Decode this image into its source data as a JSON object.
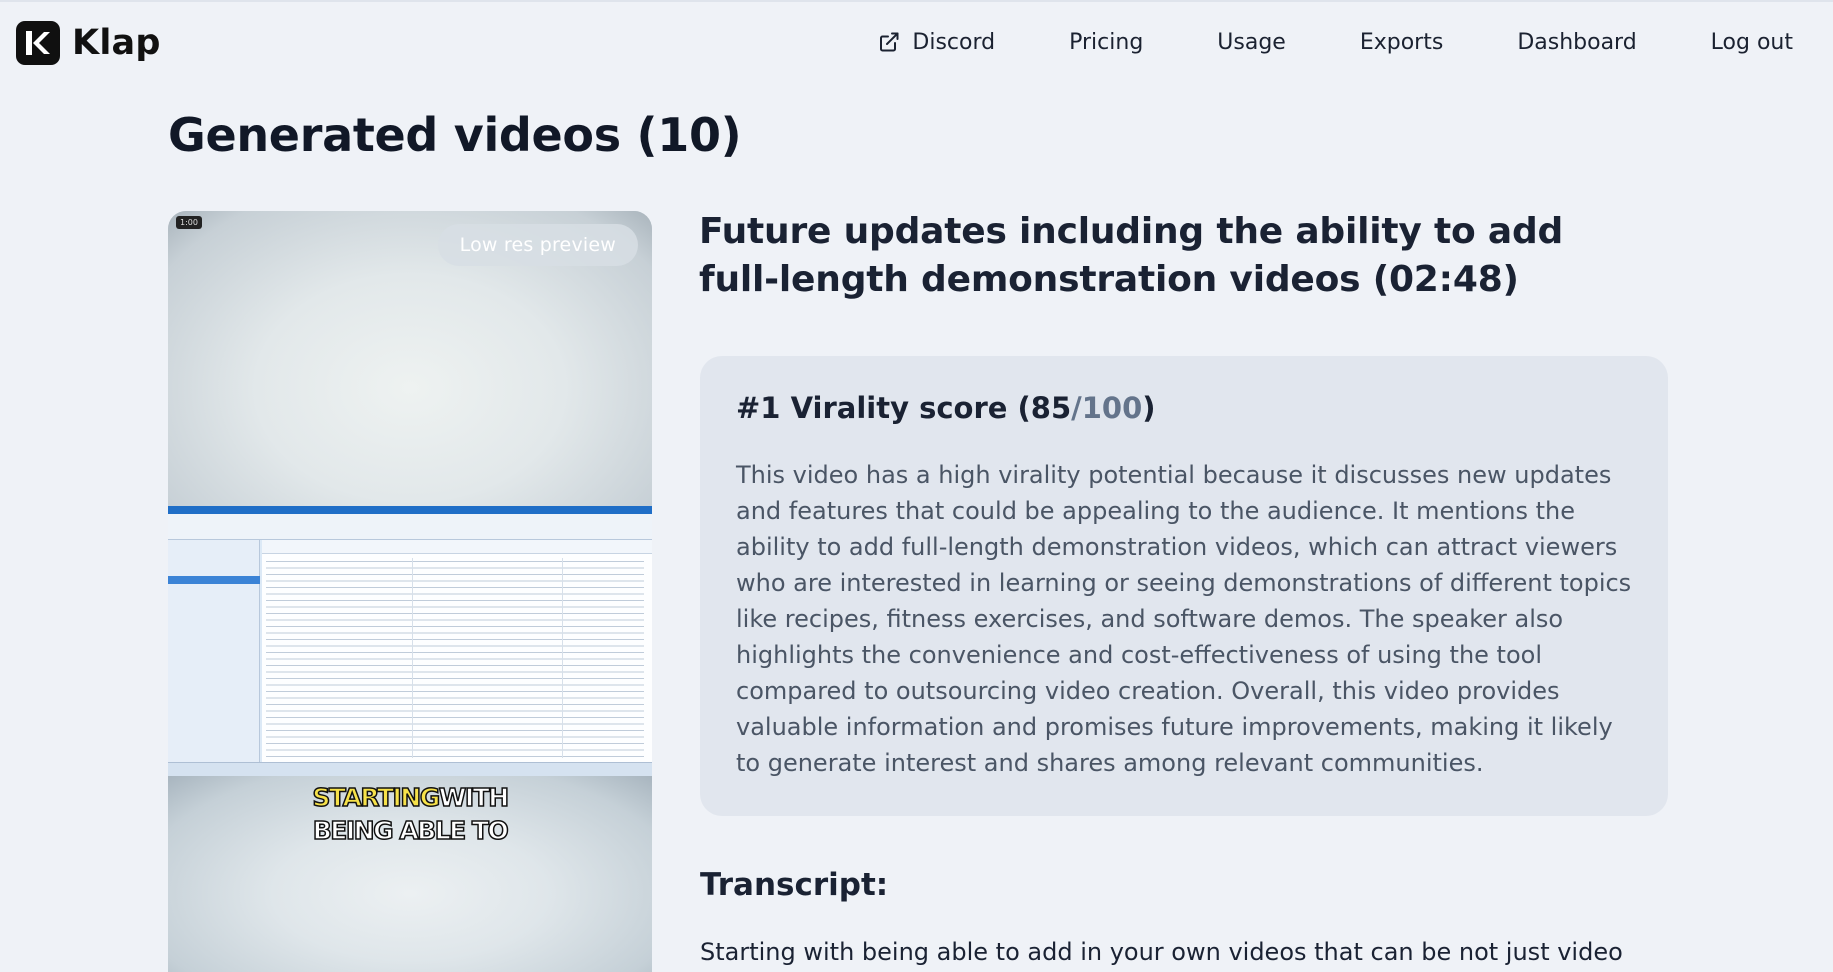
{
  "app": {
    "name": "Klap"
  },
  "nav": {
    "discord": "Discord",
    "pricing": "Pricing",
    "usage": "Usage",
    "exports": "Exports",
    "dashboard": "Dashboard",
    "logout": "Log out"
  },
  "page": {
    "title": "Generated videos (10)"
  },
  "video": {
    "timestamp": "1:00",
    "badge": "Low res preview",
    "caption_line1_word1": "STARTING",
    "caption_line1_word2": "WITH",
    "caption_line2": "BEING ABLE TO"
  },
  "clip": {
    "title": "Future updates including the ability to add full-length demonstration videos (02:48)",
    "virality_label": "#1 Virality score (",
    "virality_score": "85",
    "virality_max": "/100",
    "virality_close": ")",
    "virality_text": "This video has a high virality potential because it discusses new updates and features that could be appealing to the audience. It mentions the ability to add full-length demonstration videos, which can attract viewers who are interested in learning or seeing demonstrations of different topics like recipes, fitness exercises, and software demos. The speaker also highlights the convenience and cost-effectiveness of using the tool compared to outsourcing video creation. Overall, this video provides valuable information and promises future improvements, making it likely to generate interest and shares among relevant communities."
  },
  "transcript": {
    "heading": "Transcript:",
    "text": "Starting with being able to add in your own videos that can be not just video"
  },
  "icons": {
    "logo": "klap-logo-icon",
    "external": "external-link-icon"
  },
  "colors": {
    "background": "#eff2f7",
    "card": "#e1e6ee",
    "caption_yellow": "#f7e24a"
  }
}
